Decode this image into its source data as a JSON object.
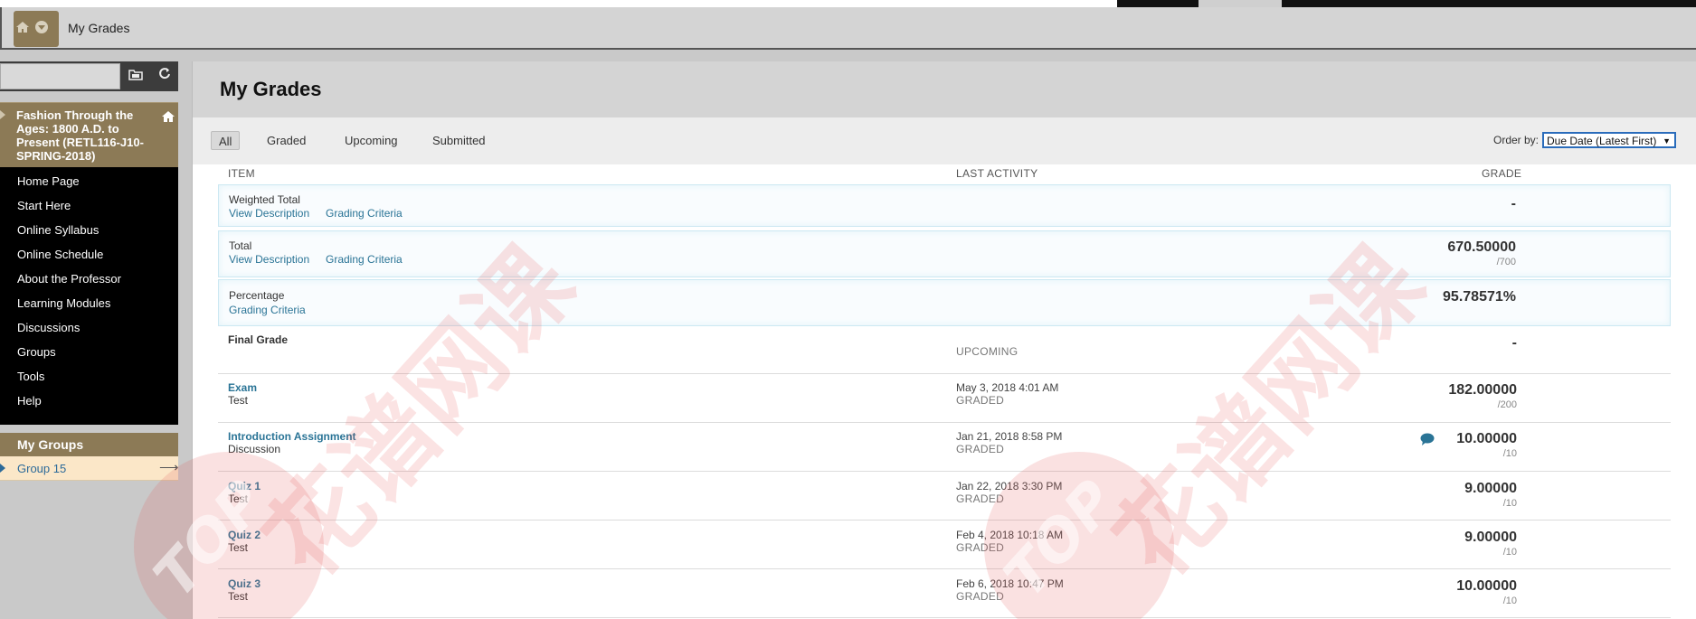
{
  "breadcrumb": {
    "title": "My Grades"
  },
  "sidebar": {
    "course_title": "Fashion Through the Ages: 1800 A.D. to Present (RETL116-J10-SPRING-2018)",
    "menu": [
      {
        "label": "Home Page"
      },
      {
        "label": "Start Here"
      },
      {
        "label": "Online Syllabus"
      },
      {
        "label": "Online Schedule"
      },
      {
        "label": "About the Professor"
      },
      {
        "label": "Learning Modules"
      },
      {
        "label": "Discussions"
      },
      {
        "label": "Groups"
      },
      {
        "label": "Tools"
      },
      {
        "label": "Help"
      }
    ],
    "groups_title": "My Groups",
    "group": "Group 15"
  },
  "main": {
    "title": "My Grades",
    "filters": [
      "All",
      "Graded",
      "Upcoming",
      "Submitted"
    ],
    "order_by_label": "Order by:",
    "order_by_value": "Due Date (Latest First)",
    "columns": {
      "item": "ITEM",
      "activity": "LAST ACTIVITY",
      "grade": "GRADE"
    },
    "links": {
      "view_description": "View Description",
      "grading_criteria": "Grading Criteria"
    },
    "rows": [
      {
        "title": "Weighted Total",
        "grade": "-"
      },
      {
        "title": "Total",
        "grade": "670.50000",
        "points": "/700"
      },
      {
        "title": "Percentage",
        "grade": "95.78571%"
      },
      {
        "title": "Final Grade",
        "status": "UPCOMING",
        "grade": "-"
      },
      {
        "title": "Exam",
        "type": "Test",
        "activity": "May 3, 2018 4:01 AM",
        "status": "GRADED",
        "grade": "182.00000",
        "points": "/200"
      },
      {
        "title": "Introduction Assignment",
        "type": "Discussion",
        "activity": "Jan 21, 2018 8:58 PM",
        "status": "GRADED",
        "grade": "10.00000",
        "points": "/10"
      },
      {
        "title": "Quiz 1",
        "type": "Test",
        "activity": "Jan 22, 2018 3:30 PM",
        "status": "GRADED",
        "grade": "9.00000",
        "points": "/10"
      },
      {
        "title": "Quiz 2",
        "type": "Test",
        "activity": "Feb 4, 2018 10:18 AM",
        "status": "GRADED",
        "grade": "9.00000",
        "points": "/10"
      },
      {
        "title": "Quiz 3",
        "type": "Test",
        "activity": "Feb 6, 2018 10:47 PM",
        "status": "GRADED",
        "grade": "10.00000",
        "points": "/10"
      }
    ]
  },
  "watermark": {
    "text": "花谱网课",
    "badge": "TOP"
  },
  "colors": {
    "accent_tan": "#8c7a56",
    "link": "#2a7496",
    "menu_bg": "#000000"
  },
  "icons": [
    "home-icon",
    "chevron-down-icon",
    "folder-icon",
    "refresh-icon",
    "arrow-right-icon",
    "comment-icon"
  ]
}
